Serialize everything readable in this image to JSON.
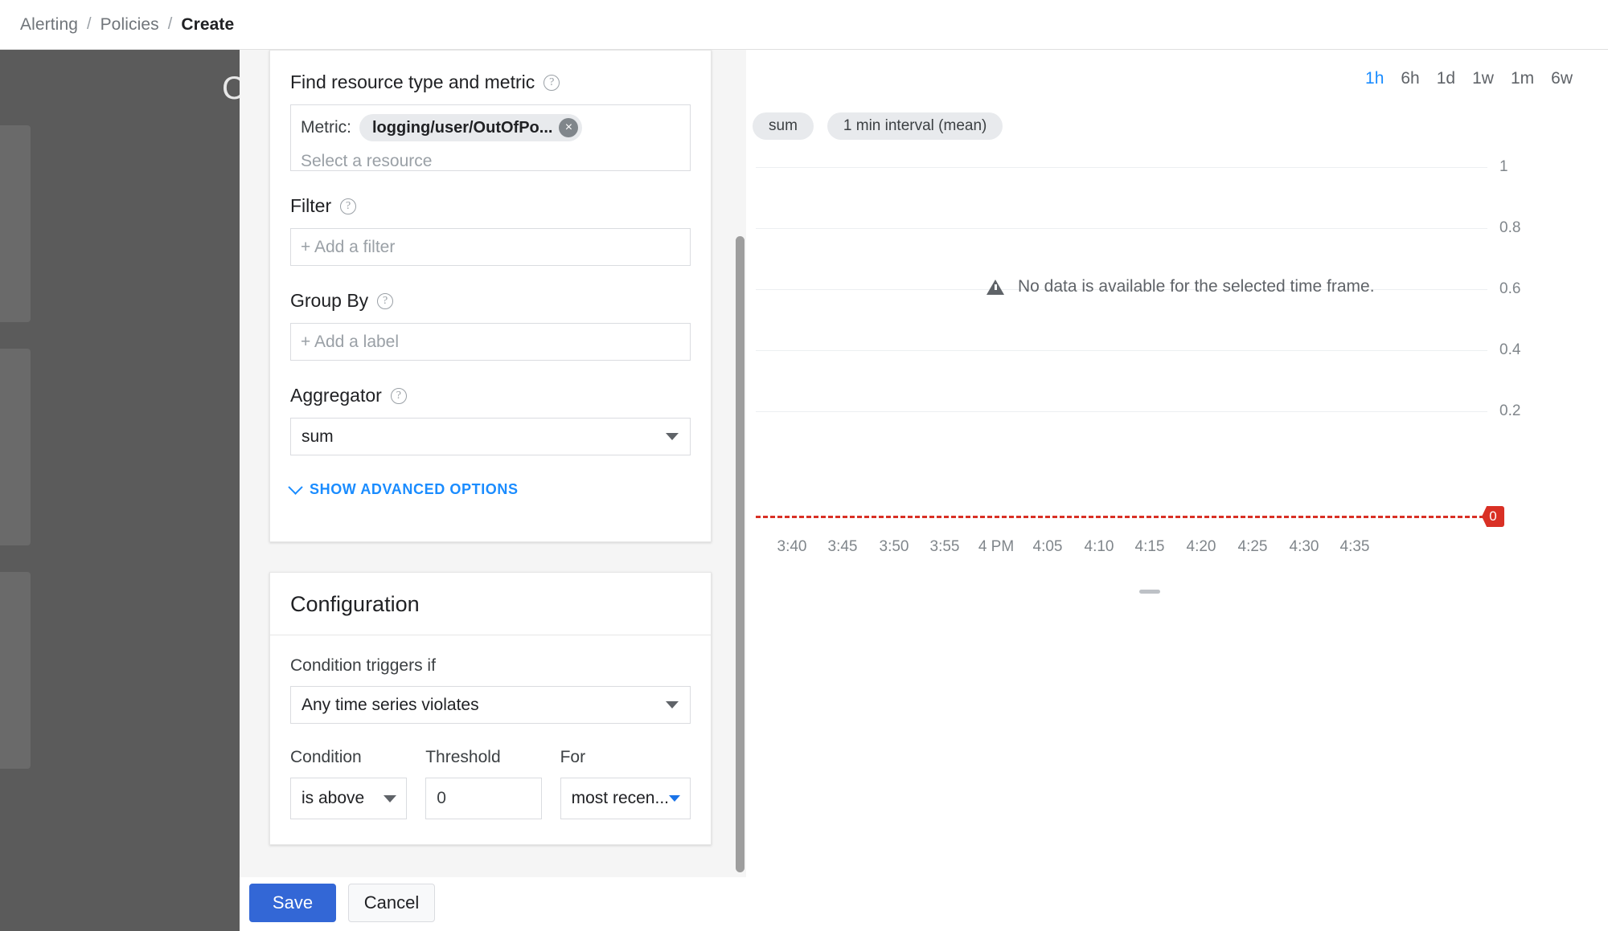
{
  "breadcrumb": {
    "items": [
      "Alerting",
      "Policies",
      "Create"
    ],
    "separator": "/"
  },
  "background": {
    "obscured_title": "C"
  },
  "metric_card": {
    "heading": "Find resource type and metric",
    "help_glyph": "?",
    "metric_label": "Metric:",
    "metric_value": "logging/user/OutOfPo...",
    "remove_glyph": "×",
    "resource_placeholder": "Select a resource",
    "filter_label": "Filter",
    "filter_placeholder": "+ Add a filter",
    "group_by_label": "Group By",
    "group_by_placeholder": "+ Add a label",
    "aggregator_label": "Aggregator",
    "aggregator_value": "sum",
    "advanced_options_label": "SHOW ADVANCED OPTIONS"
  },
  "configuration_card": {
    "title": "Configuration",
    "condition_triggers_label": "Condition triggers if",
    "condition_triggers_value": "Any time series violates",
    "condition_label": "Condition",
    "condition_value": "is above",
    "threshold_label": "Threshold",
    "threshold_value": "0",
    "for_label": "For",
    "for_value": "most recen..."
  },
  "footer": {
    "save_label": "Save",
    "cancel_label": "Cancel"
  },
  "chart": {
    "time_ranges": [
      "1h",
      "6h",
      "1d",
      "1w",
      "1m",
      "6w"
    ],
    "active_range": "1h",
    "chips": [
      "sum",
      "1 min interval (mean)"
    ],
    "no_data_message": "No data is available for the selected time frame.",
    "threshold_marker": "0"
  },
  "chart_data": {
    "type": "line",
    "title": "",
    "xlabel": "",
    "ylabel": "",
    "series": [
      {
        "name": "sum",
        "values": []
      }
    ],
    "x": [
      "3:40",
      "3:45",
      "3:50",
      "3:55",
      "4 PM",
      "4:05",
      "4:10",
      "4:15",
      "4:20",
      "4:25",
      "4:30",
      "4:35"
    ],
    "yticks": [
      0.2,
      0.4,
      0.6,
      0.8,
      1.0
    ],
    "ylim": [
      0,
      1.05
    ],
    "grid": true,
    "legend": "none",
    "annotations": [
      {
        "text": "No data is available for the selected time frame.",
        "type": "empty-state"
      },
      {
        "text": "0",
        "type": "threshold",
        "value": 0,
        "color": "#d93025",
        "style": "dashed"
      }
    ],
    "colors": {
      "threshold": "#d93025",
      "accent": "#1a8cff",
      "grid": "#eceff1"
    }
  }
}
